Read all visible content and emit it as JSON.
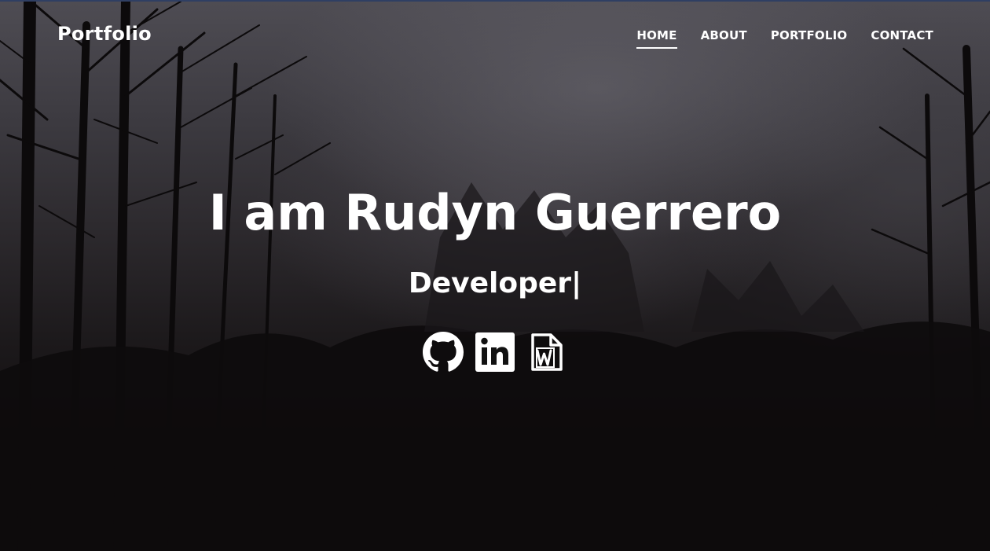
{
  "navbar": {
    "brand": "Portfolio",
    "links": [
      {
        "label": "HOME",
        "active": true
      },
      {
        "label": "ABOUT",
        "active": false
      },
      {
        "label": "PORTFOLIO",
        "active": false
      },
      {
        "label": "CONTACT",
        "active": false
      }
    ]
  },
  "hero": {
    "title": "I am Rudyn Guerrero",
    "subtitle": "Developer|",
    "social_icons": [
      "github-icon",
      "linkedin-icon",
      "word-document-icon"
    ]
  },
  "colors": {
    "text": "#ffffff",
    "top_border": "#2f3f63"
  }
}
